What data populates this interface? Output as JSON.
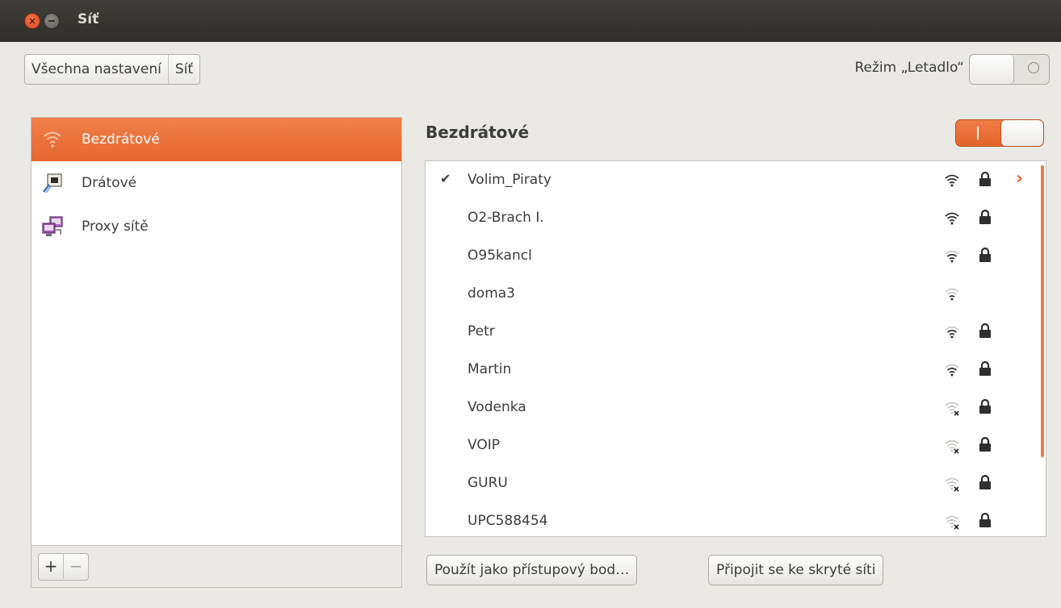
{
  "window": {
    "title": "Síť"
  },
  "breadcrumb": {
    "all_settings": "Všechna nastavení",
    "current": "Síť"
  },
  "airplane_mode": {
    "label": "Režim „Letadlo“",
    "enabled": false
  },
  "sidebar": {
    "items": [
      {
        "label": "Bezdrátové",
        "icon": "wifi-icon",
        "active": true
      },
      {
        "label": "Drátové",
        "icon": "wired-network-icon",
        "active": false
      },
      {
        "label": "Proxy sítě",
        "icon": "proxy-network-icon",
        "active": false
      }
    ],
    "add_label": "+",
    "remove_label": "−"
  },
  "wireless": {
    "title": "Bezdrátové",
    "enabled": true,
    "switch_on_label": "I",
    "networks": [
      {
        "ssid": "Volim_Piraty",
        "connected": true,
        "check": "✔",
        "strength": 3,
        "secured": true,
        "arrow": "›"
      },
      {
        "ssid": "O2-Brach I.",
        "connected": false,
        "check": "",
        "strength": 3,
        "secured": true,
        "arrow": ""
      },
      {
        "ssid": "O95kancl",
        "connected": false,
        "check": "",
        "strength": 2,
        "secured": true,
        "arrow": ""
      },
      {
        "ssid": "doma3",
        "connected": false,
        "check": "",
        "strength": 1,
        "secured": false,
        "arrow": ""
      },
      {
        "ssid": "Petr",
        "connected": false,
        "check": "",
        "strength": 2,
        "secured": true,
        "arrow": ""
      },
      {
        "ssid": "Martin",
        "connected": false,
        "check": "",
        "strength": 2,
        "secured": true,
        "arrow": ""
      },
      {
        "ssid": "Vodenka",
        "connected": false,
        "check": "",
        "strength": 0,
        "secured": true,
        "arrow": ""
      },
      {
        "ssid": "VOIP",
        "connected": false,
        "check": "",
        "strength": 0,
        "secured": true,
        "arrow": ""
      },
      {
        "ssid": "GURU",
        "connected": false,
        "check": "",
        "strength": 0,
        "secured": true,
        "arrow": ""
      },
      {
        "ssid": "UPC588454",
        "connected": false,
        "check": "",
        "strength": 0,
        "secured": true,
        "arrow": ""
      }
    ]
  },
  "actions": {
    "hotspot": "Použít jako přístupový bod…",
    "hidden_network": "Připojit se ke skryté síti"
  },
  "colors": {
    "accent": "#e5672e",
    "titlebar": "#3c3b37"
  }
}
